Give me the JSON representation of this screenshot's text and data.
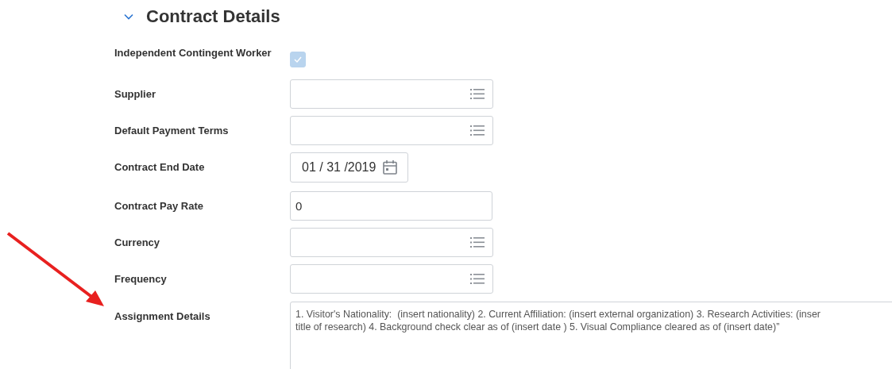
{
  "section": {
    "title": "Contract Details",
    "expanded": true
  },
  "fields": [
    {
      "kind": "checkbox",
      "label": "Independent Contingent Worker",
      "checked": true
    },
    {
      "kind": "select",
      "label": "Supplier"
    },
    {
      "kind": "select",
      "label": "Default Payment Terms"
    },
    {
      "kind": "date",
      "label": "Contract End Date",
      "value": "01 / 31 /2019"
    },
    {
      "kind": "text",
      "label": "Contract Pay Rate",
      "value": "0"
    },
    {
      "kind": "select",
      "label": "Currency"
    },
    {
      "kind": "select",
      "label": "Frequency"
    },
    {
      "kind": "textarea",
      "label": "Assignment Details",
      "lines": [
        "1. Visitor's Nationality:  (insert nationality) 2. Current Affiliation: (insert external organization) 3. Research Activities: (inser",
        "title of research) 4. Background check clear as of (insert date ) 5. Visual Compliance cleared as of (insert date)”"
      ]
    }
  ]
}
